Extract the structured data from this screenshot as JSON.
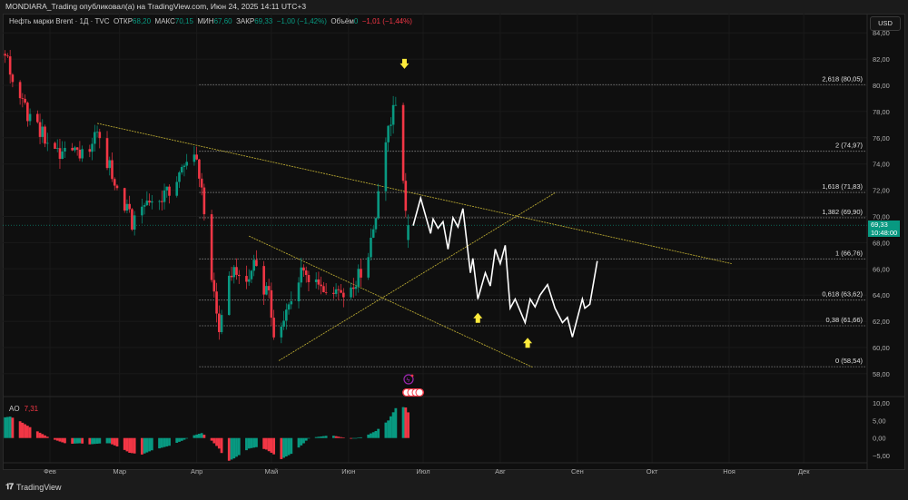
{
  "header": {
    "publisher_line": "MONDIARA_Trading опубликовал(а) на TradingView.com, Июн 24, 2025 14:11 UTC+3",
    "symbol": "Нефть марки Brent · 1Д · TVC",
    "open_label": "ОТКР",
    "open": "68,20",
    "high_label": "МАКС",
    "high": "70,15",
    "low_label": "МИН",
    "low": "67,60",
    "close_label": "ЗАКР",
    "close": "69,33",
    "change": "−1,00 (−1,42%)",
    "volume_label": "Объём",
    "volume": "0",
    "volume_change": "−1,01 (−1,44%)"
  },
  "currency_button": "USD",
  "last_price": {
    "price": "69,33",
    "countdown": "10:48:00"
  },
  "indicator": {
    "name": "AO",
    "value": "7,31"
  },
  "footer": {
    "brand": "TradingView"
  },
  "colors": {
    "up": "#089981",
    "down": "#f23645",
    "projection": "#ffffff",
    "trendline": "#b5a531",
    "arrow": "#ffeb3b",
    "fib": "#8a8a8a"
  },
  "chart_data": {
    "type": "candlestick",
    "x_unit": "day of year 2025 (Jan 1 = 0)",
    "ylim": [
      57,
      85
    ],
    "price_ticks": [
      "84,00",
      "82,00",
      "80,00",
      "78,00",
      "76,00",
      "74,00",
      "72,00",
      "70,00",
      "68,00",
      "66,00",
      "64,00",
      "62,00",
      "60,00",
      "58,00"
    ],
    "price_tick_values": [
      84,
      82,
      80,
      78,
      76,
      74,
      72,
      70,
      68,
      66,
      64,
      62,
      60,
      58
    ],
    "time_ticks": [
      {
        "label": "Фев",
        "day": 31
      },
      {
        "label": "Мар",
        "day": 59
      },
      {
        "label": "Апр",
        "day": 90
      },
      {
        "label": "Май",
        "day": 120
      },
      {
        "label": "Июн",
        "day": 151
      },
      {
        "label": "Июл",
        "day": 181
      },
      {
        "label": "Авг",
        "day": 212
      },
      {
        "label": "Сен",
        "day": 243
      },
      {
        "label": "Окт",
        "day": 273
      },
      {
        "label": "Ноя",
        "day": 304
      },
      {
        "label": "Дек",
        "day": 334
      }
    ],
    "price_path": [
      [
        13,
        82.4
      ],
      [
        18,
        79
      ],
      [
        29,
        76
      ],
      [
        38,
        74.4
      ],
      [
        51,
        76
      ],
      [
        58,
        72
      ],
      [
        64,
        69.5
      ],
      [
        69,
        71
      ],
      [
        78,
        71.6
      ],
      [
        86,
        74
      ],
      [
        90,
        74.8
      ],
      [
        93,
        70
      ],
      [
        97,
        63.8
      ],
      [
        99,
        61.5
      ],
      [
        104,
        65.8
      ],
      [
        110,
        64.4
      ],
      [
        113,
        66.5
      ],
      [
        119,
        63.8
      ],
      [
        122,
        60
      ],
      [
        128,
        63.8
      ],
      [
        133,
        66
      ],
      [
        139,
        65
      ],
      [
        146,
        64.4
      ],
      [
        151,
        64.4
      ],
      [
        157,
        65.8
      ],
      [
        161,
        69.2
      ],
      [
        164,
        72.7
      ],
      [
        168,
        77.5
      ],
      [
        171,
        78.5
      ],
      [
        174,
        70
      ],
      [
        175,
        69.33
      ]
    ],
    "last_candle": {
      "open": 68.2,
      "high": 70.15,
      "low": 67.6,
      "close": 69.33
    },
    "fib_levels": [
      {
        "label": "2,618 (80,05)",
        "price": 80.05
      },
      {
        "label": "2 (74,97)",
        "price": 74.97
      },
      {
        "label": "1,618 (71,83)",
        "price": 71.83
      },
      {
        "label": "1,382 (69,90)",
        "price": 69.9
      },
      {
        "label": "1 (66,76)",
        "price": 66.76
      },
      {
        "label": "0,618 (63,62)",
        "price": 63.62
      },
      {
        "label": "0,38 (61,66)",
        "price": 61.66
      },
      {
        "label": "0 (58,54)",
        "price": 58.54
      }
    ],
    "fib_start_day": 91,
    "trendlines": [
      [
        [
          50,
          77.1
        ],
        [
          305,
          66.4
        ]
      ],
      [
        [
          111,
          68.5
        ],
        [
          225,
          58.5
        ]
      ],
      [
        [
          123,
          59
        ],
        [
          234,
          71.8
        ]
      ]
    ],
    "projection": [
      [
        177,
        69.3
      ],
      [
        180,
        71.4
      ],
      [
        184,
        68.7
      ],
      [
        185,
        69.8
      ],
      [
        187,
        69.1
      ],
      [
        189,
        69.6
      ],
      [
        191,
        67.5
      ],
      [
        193,
        69.9
      ],
      [
        195,
        69.2
      ],
      [
        197,
        70.6
      ],
      [
        200,
        65.7
      ],
      [
        201,
        66.8
      ],
      [
        203,
        63.7
      ],
      [
        206,
        65.7
      ],
      [
        208,
        64.7
      ],
      [
        210,
        67.5
      ],
      [
        212,
        66.4
      ],
      [
        214,
        67.8
      ],
      [
        216,
        63
      ],
      [
        218,
        63.7
      ],
      [
        222,
        61.9
      ],
      [
        224,
        63.7
      ],
      [
        226,
        63.1
      ],
      [
        228,
        64
      ],
      [
        231,
        64.8
      ],
      [
        234,
        63
      ],
      [
        237,
        61.9
      ],
      [
        239,
        62.3
      ],
      [
        241,
        60.8
      ],
      [
        245,
        63.7
      ],
      [
        246,
        63
      ],
      [
        248,
        63.3
      ],
      [
        251,
        66.6
      ]
    ],
    "arrows": [
      {
        "direction": "down",
        "day": 173.5,
        "price": 81.6
      },
      {
        "direction": "up",
        "day": 203,
        "price": 62.3
      },
      {
        "direction": "up",
        "day": 223,
        "price": 60.4
      }
    ],
    "ao": {
      "ticks": [
        "10,00",
        "5,00",
        "0,00",
        "−5,00"
      ],
      "tick_values": [
        10,
        5,
        0,
        -5
      ],
      "path": [
        [
          13,
          5.9
        ],
        [
          15,
          6.1
        ],
        [
          18,
          5.2
        ],
        [
          22,
          3.5
        ],
        [
          27,
          1.5
        ],
        [
          31,
          0
        ],
        [
          35,
          -1
        ],
        [
          38,
          -1.7
        ],
        [
          43,
          -1.5
        ],
        [
          47,
          -1.8
        ],
        [
          52,
          -1.5
        ],
        [
          55,
          -1.5
        ],
        [
          60,
          -3
        ],
        [
          63,
          -4.2
        ],
        [
          68,
          -4.7
        ],
        [
          72,
          -3.5
        ],
        [
          79,
          -2.2
        ],
        [
          84,
          -0.8
        ],
        [
          89,
          0.8
        ],
        [
          92,
          1.4
        ],
        [
          95,
          0
        ],
        [
          99,
          -3
        ],
        [
          102,
          -6.8
        ],
        [
          105,
          -5.8
        ],
        [
          111,
          -3
        ],
        [
          114,
          -2.6
        ],
        [
          118,
          -3.3
        ],
        [
          124,
          -6
        ],
        [
          128,
          -4.5
        ],
        [
          133,
          -1.5
        ],
        [
          135,
          0
        ],
        [
          144,
          0.8
        ],
        [
          149,
          0.1
        ],
        [
          152,
          -0.2
        ],
        [
          157,
          0.3
        ],
        [
          162,
          2
        ],
        [
          167,
          5
        ],
        [
          170,
          8.5
        ],
        [
          172,
          8.9
        ],
        [
          174,
          8.7
        ],
        [
          175,
          7.31
        ]
      ]
    }
  }
}
